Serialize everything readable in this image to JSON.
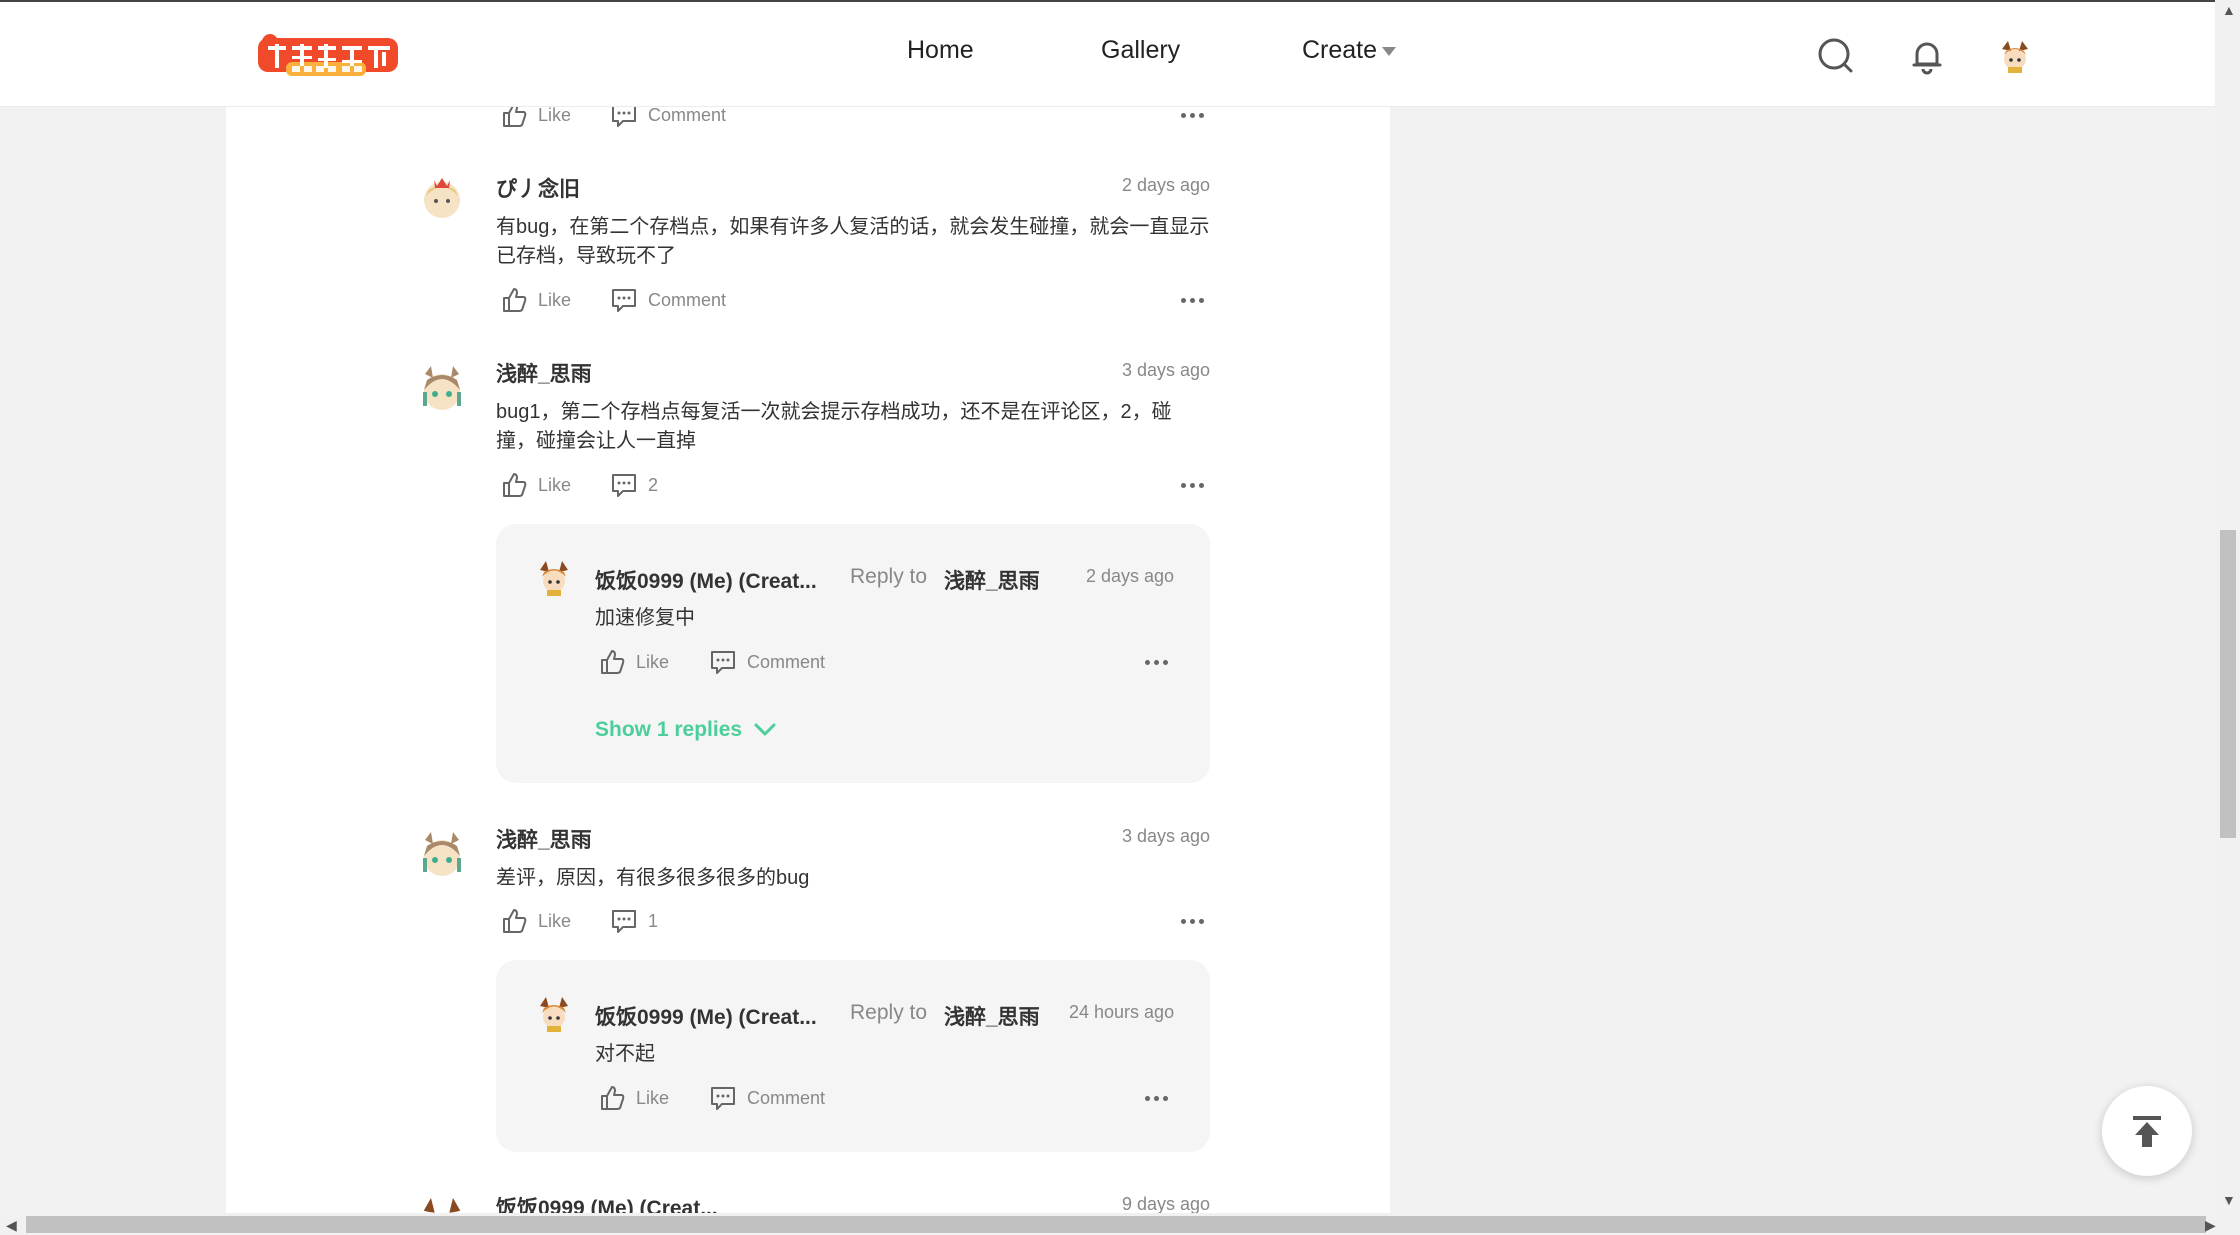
{
  "nav": {
    "home": "Home",
    "gallery": "Gallery",
    "create": "Create"
  },
  "actions": {
    "like": "Like",
    "comment": "Comment",
    "reply_to": "Reply to",
    "show_replies": "Show 1 replies"
  },
  "comments": [
    {
      "user": "ぴ丿念旧",
      "time": "2 days ago",
      "text": "有bug，在第二个存档点，如果有许多人复活的话，就会发生碰撞，就会一直显示已存档，导致玩不了",
      "comment_count": "Comment"
    },
    {
      "user": "浅醉_思雨",
      "time": "3 days ago",
      "text": "bug1，第二个存档点每复活一次就会提示存档成功，还不是在评论区，2，碰撞，碰撞会让人一直掉",
      "comment_count": "2",
      "reply": {
        "user": "饭饭0999 (Me) (Creat...",
        "to": "浅醉_思雨",
        "time": "2 days ago",
        "text": "加速修复中"
      }
    },
    {
      "user": "浅醉_思雨",
      "time": "3 days ago",
      "text": "差评，原因，有很多很多很多的bug",
      "comment_count": "1",
      "reply": {
        "user": "饭饭0999 (Me) (Creat...",
        "to": "浅醉_思雨",
        "time": "24 hours ago",
        "text": "对不起"
      }
    },
    {
      "user": "饭饭0999 (Me) (Creat...",
      "time": "9 days ago"
    }
  ],
  "colors": {
    "accent": "#4cce9a",
    "page_bg": "#f2f2f2",
    "logo_red": "#f04a2a"
  },
  "icons": [
    "search-icon",
    "bell-icon",
    "thumbs-up-icon",
    "comment-icon",
    "more-icon",
    "back-to-top-icon"
  ]
}
